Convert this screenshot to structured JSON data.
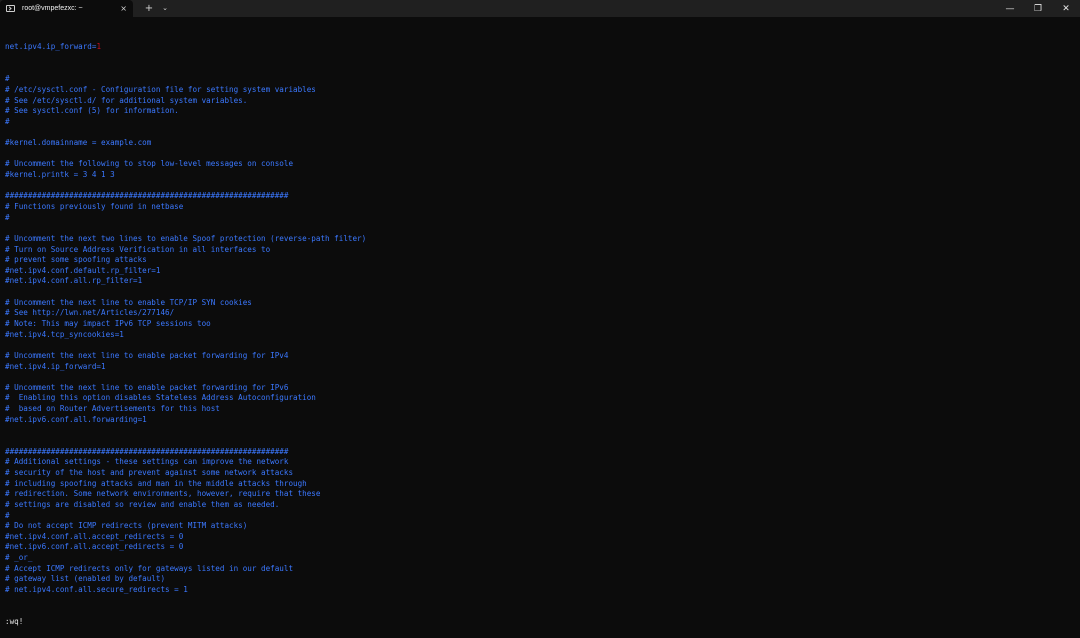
{
  "window": {
    "tab_title": "root@vmpefezxc: ~",
    "tab_close_glyph": "×",
    "new_tab_glyph": "+",
    "dropdown_glyph": "⌄",
    "minimize_glyph": "—",
    "maximize_glyph": "❐",
    "close_glyph": "✕"
  },
  "colors": {
    "background": "#0c0c0c",
    "comment_blue": "#3b78ff",
    "number_red": "#c50f1f",
    "text_white": "#e6e6e6"
  },
  "editor": {
    "first_line_key": "net.ipv4.ip_forward=",
    "first_line_value": "1",
    "lines": [
      "#",
      "# /etc/sysctl.conf - Configuration file for setting system variables",
      "# See /etc/sysctl.d/ for additional system variables.",
      "# See sysctl.conf (5) for information.",
      "#",
      "",
      "#kernel.domainname = example.com",
      "",
      "# Uncomment the following to stop low-level messages on console",
      "#kernel.printk = 3 4 1 3",
      "",
      "##############################################################",
      "# Functions previously found in netbase",
      "#",
      "",
      "# Uncomment the next two lines to enable Spoof protection (reverse-path filter)",
      "# Turn on Source Address Verification in all interfaces to",
      "# prevent some spoofing attacks",
      "#net.ipv4.conf.default.rp_filter=1",
      "#net.ipv4.conf.all.rp_filter=1",
      "",
      "# Uncomment the next line to enable TCP/IP SYN cookies",
      "# See http://lwn.net/Articles/277146/",
      "# Note: This may impact IPv6 TCP sessions too",
      "#net.ipv4.tcp_syncookies=1",
      "",
      "# Uncomment the next line to enable packet forwarding for IPv4",
      "#net.ipv4.ip_forward=1",
      "",
      "# Uncomment the next line to enable packet forwarding for IPv6",
      "#  Enabling this option disables Stateless Address Autoconfiguration",
      "#  based on Router Advertisements for this host",
      "#net.ipv6.conf.all.forwarding=1",
      "",
      "",
      "##############################################################",
      "# Additional settings - these settings can improve the network",
      "# security of the host and prevent against some network attacks",
      "# including spoofing attacks and man in the middle attacks through",
      "# redirection. Some network environments, however, require that these",
      "# settings are disabled so review and enable them as needed.",
      "#",
      "# Do not accept ICMP redirects (prevent MITM attacks)",
      "#net.ipv4.conf.all.accept_redirects = 0",
      "#net.ipv6.conf.all.accept_redirects = 0",
      "# _or_",
      "# Accept ICMP redirects only for gateways listed in our default",
      "# gateway list (enabled by default)",
      "# net.ipv4.conf.all.secure_redirects = 1"
    ],
    "command_line": ":wq!"
  }
}
